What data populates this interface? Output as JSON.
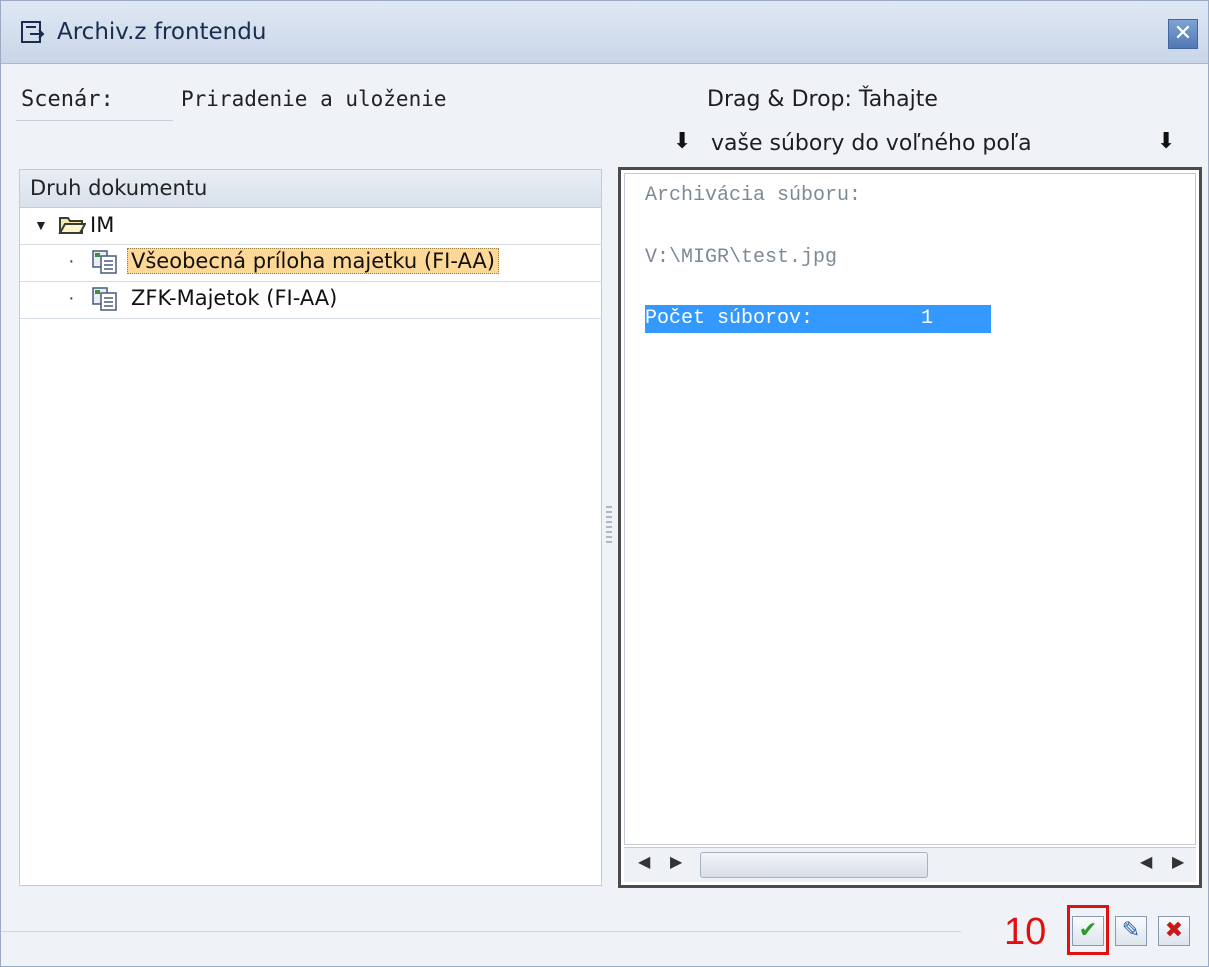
{
  "window": {
    "title": "Archiv.z frontendu",
    "close_icon": "close-icon"
  },
  "header": {
    "scenario_label": "Scenár:",
    "scenario_value": "Priradenie a uloženie",
    "drag_drop_line1": "Drag & Drop: Ťahajte",
    "drag_drop_line2": "vaše súbory do voľného poľa",
    "arrow_glyph": "🡇"
  },
  "tree": {
    "header": "Druh dokumentu",
    "root": {
      "label": "IM",
      "icon": "folder-open-icon",
      "expanded": true
    },
    "items": [
      {
        "label": "Všeobecná príloha majetku  (FI-AA)",
        "icon": "document-type-icon",
        "selected": true
      },
      {
        "label": "ZFK-Majetok (FI-AA)",
        "icon": "document-type-icon",
        "selected": false
      }
    ]
  },
  "drop_area": {
    "line1": "Archivácia súboru:",
    "line2": "V:\\MIGR\\test.jpg",
    "count_label": "Počet súborov:         1"
  },
  "footer": {
    "step_number": "10",
    "confirm_icon": "checkmark-icon",
    "edit_icon": "edit-icon",
    "cancel_icon": "cancel-x-icon"
  },
  "colors": {
    "selection_highlight": "#fdd896",
    "text_selection": "#3399ff",
    "annotation_red": "#e01010",
    "confirm_green": "#2a9a2a"
  }
}
